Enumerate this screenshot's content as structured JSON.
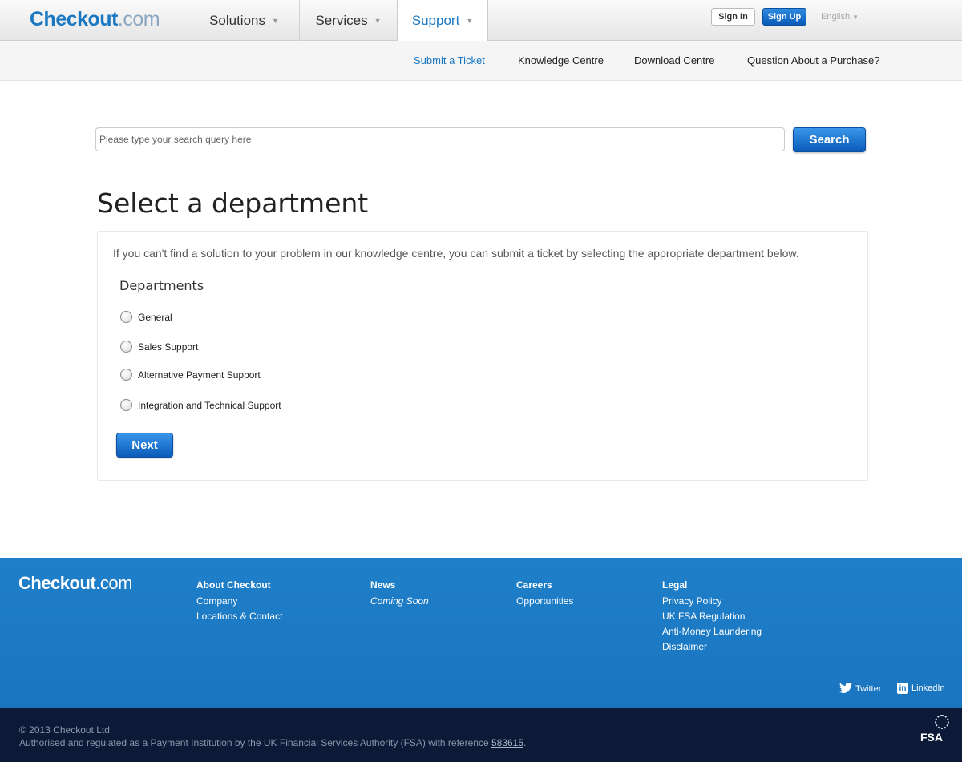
{
  "header": {
    "logo_brand": "Checkout",
    "logo_domain": ".com",
    "nav": [
      {
        "label": "Solutions"
      },
      {
        "label": "Services"
      },
      {
        "label": "Support"
      }
    ],
    "signin_label": "Sign In",
    "signup_label": "Sign Up",
    "language": "English"
  },
  "subnav": {
    "items": [
      {
        "label": "Submit a Ticket"
      },
      {
        "label": "Knowledge Centre"
      },
      {
        "label": "Download Centre"
      },
      {
        "label": "Question About a Purchase?"
      }
    ]
  },
  "search": {
    "placeholder": "Please type your search query here",
    "button_label": "Search"
  },
  "main": {
    "title": "Select a department",
    "intro": "If you can't find a solution to your problem in our knowledge centre, you can submit a ticket by selecting the appropriate department below.",
    "departments_heading": "Departments",
    "departments": [
      {
        "label": "General"
      },
      {
        "label": "Sales Support"
      },
      {
        "label": "Alternative Payment Support"
      },
      {
        "label": "Integration and Technical Support"
      }
    ],
    "next_label": "Next"
  },
  "footer": {
    "logo_brand": "Checkout",
    "logo_domain": ".com",
    "columns": [
      {
        "heading": "About Checkout",
        "links": [
          "Company",
          "Locations & Contact"
        ]
      },
      {
        "heading": "News",
        "links": [
          "Coming Soon"
        ]
      },
      {
        "heading": "Careers",
        "links": [
          "Opportunities"
        ]
      },
      {
        "heading": "Legal",
        "links": [
          "Privacy Policy",
          "UK FSA Regulation",
          "Anti-Money Laundering",
          "Disclaimer"
        ]
      }
    ],
    "twitter_label": "Twitter",
    "linkedin_label": "LinkedIn",
    "copyright": "© 2013 Checkout Ltd.",
    "regulation_text": "Authorised and regulated as a Payment Institution by the UK Financial Services Authority (FSA) with reference",
    "reference": "583615",
    "fsa_badge": "FSA"
  },
  "colors": {
    "accent": "#1a78c2",
    "footer_bg": "#1a75bf",
    "bottom_bg": "#0c1a38"
  }
}
